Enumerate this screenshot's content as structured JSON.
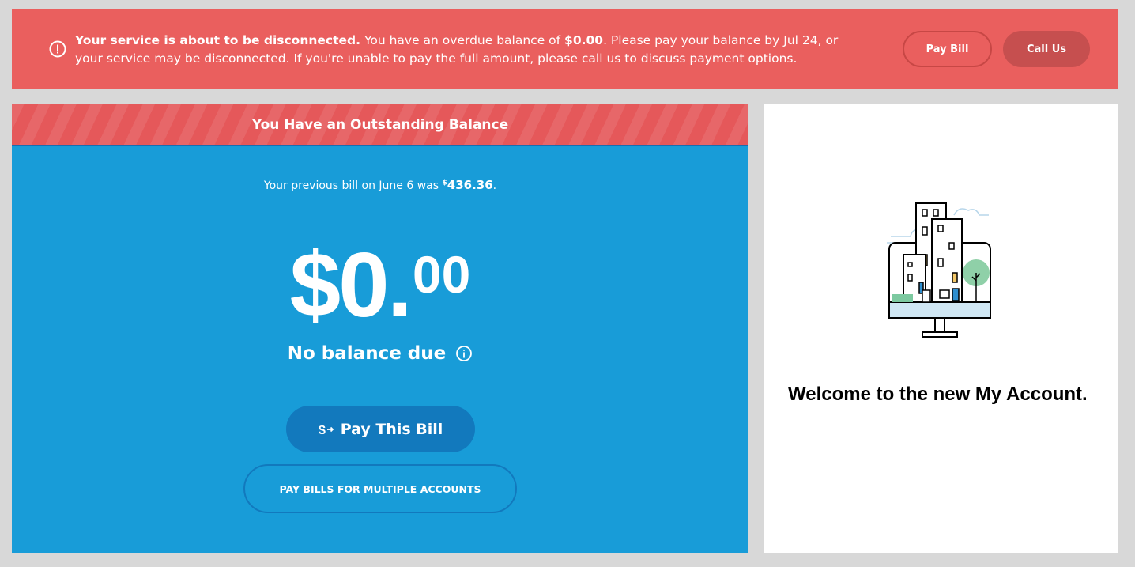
{
  "alert": {
    "headline": "Your service is about to be disconnected.",
    "text_before_amount": " You have an overdue balance of ",
    "amount": "$0.00",
    "text_after_amount": ". Please pay your balance by Jul 24, or your service may be disconnected. If you're unable to pay the full amount, please call us to discuss payment options.",
    "pay_bill_label": "Pay Bill",
    "call_us_label": "Call Us",
    "icon": "exclamation-circle-icon"
  },
  "billing": {
    "banner_title": "You Have an Outstanding Balance",
    "previous_bill_prefix": "Your previous bill on June 6 was ",
    "previous_bill_currency": "$",
    "previous_bill_amount": "436.36",
    "previous_bill_suffix": ".",
    "balance_dollars": "$0",
    "balance_dot": ".",
    "balance_cents": "00",
    "balance_status": "No balance due",
    "pay_this_bill_label": "Pay This Bill",
    "pay_multiple_label": "PAY BILLS FOR MULTIPLE ACCOUNTS",
    "info_icon": "info-circle-icon",
    "pay_icon": "dollar-arrow-icon"
  },
  "welcome": {
    "title": "Welcome to the new My Account.",
    "illustration": "city-monitor-illustration"
  },
  "colors": {
    "alert_bg": "#ea5f5e",
    "billing_bg": "#189cd8",
    "button_blue": "#1279bd",
    "call_us_bg": "#c64f4f"
  }
}
